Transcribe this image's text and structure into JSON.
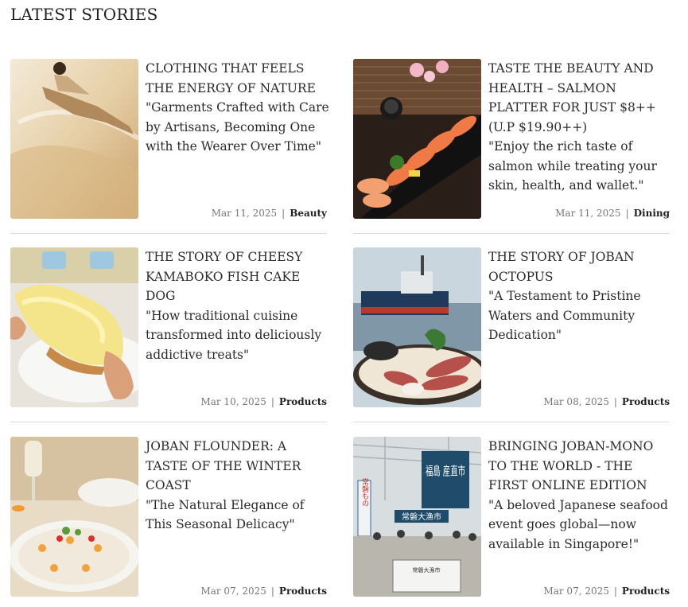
{
  "section": {
    "title": "LATEST STORIES"
  },
  "stories": [
    {
      "title": "CLOTHING THAT FEELS THE ENERGY OF NATURE",
      "quote": "\"Garments Crafted with Care by Artisans, Becoming One with the Wearer Over Time\"",
      "date": "Mar 11, 2025",
      "category": "Beauty"
    },
    {
      "title": "TASTE THE BEAUTY AND HEALTH – SALMON PLATTER FOR JUST $8++ (U.P $19.90++)",
      "quote": "\"Enjoy the rich taste of salmon while treating your skin, health, and wallet.\"",
      "date": "Mar 11, 2025",
      "category": "Dining"
    },
    {
      "title": "THE STORY OF CHEESY KAMABOKO FISH CAKE DOG",
      "quote": "\"How traditional cuisine transformed into deliciously addictive treats\"",
      "date": "Mar 10, 2025",
      "category": "Products"
    },
    {
      "title": "THE STORY OF JOBAN OCTOPUS",
      "quote": "\"A Testament to Pristine Waters and Community Dedication\"",
      "date": "Mar 08, 2025",
      "category": "Products"
    },
    {
      "title": "JOBAN FLOUNDER: A TASTE OF THE WINTER COAST",
      "quote": "\"The Natural Elegance of This Seasonal Delicacy\"",
      "date": "Mar 07, 2025",
      "category": "Products"
    },
    {
      "title": "BRINGING JOBAN-MONO TO THE WORLD - THE FIRST ONLINE EDITION",
      "quote": "\"A beloved Japanese seafood event goes global—now available in Singapore!\"",
      "date": "Mar 07, 2025",
      "category": "Products"
    }
  ],
  "photo_signage": {
    "banner_right": "福島 産直市",
    "banner_center": "常磐大漁市",
    "banner_left": "常磐もの",
    "stall_sign": "常磐大漁市"
  }
}
